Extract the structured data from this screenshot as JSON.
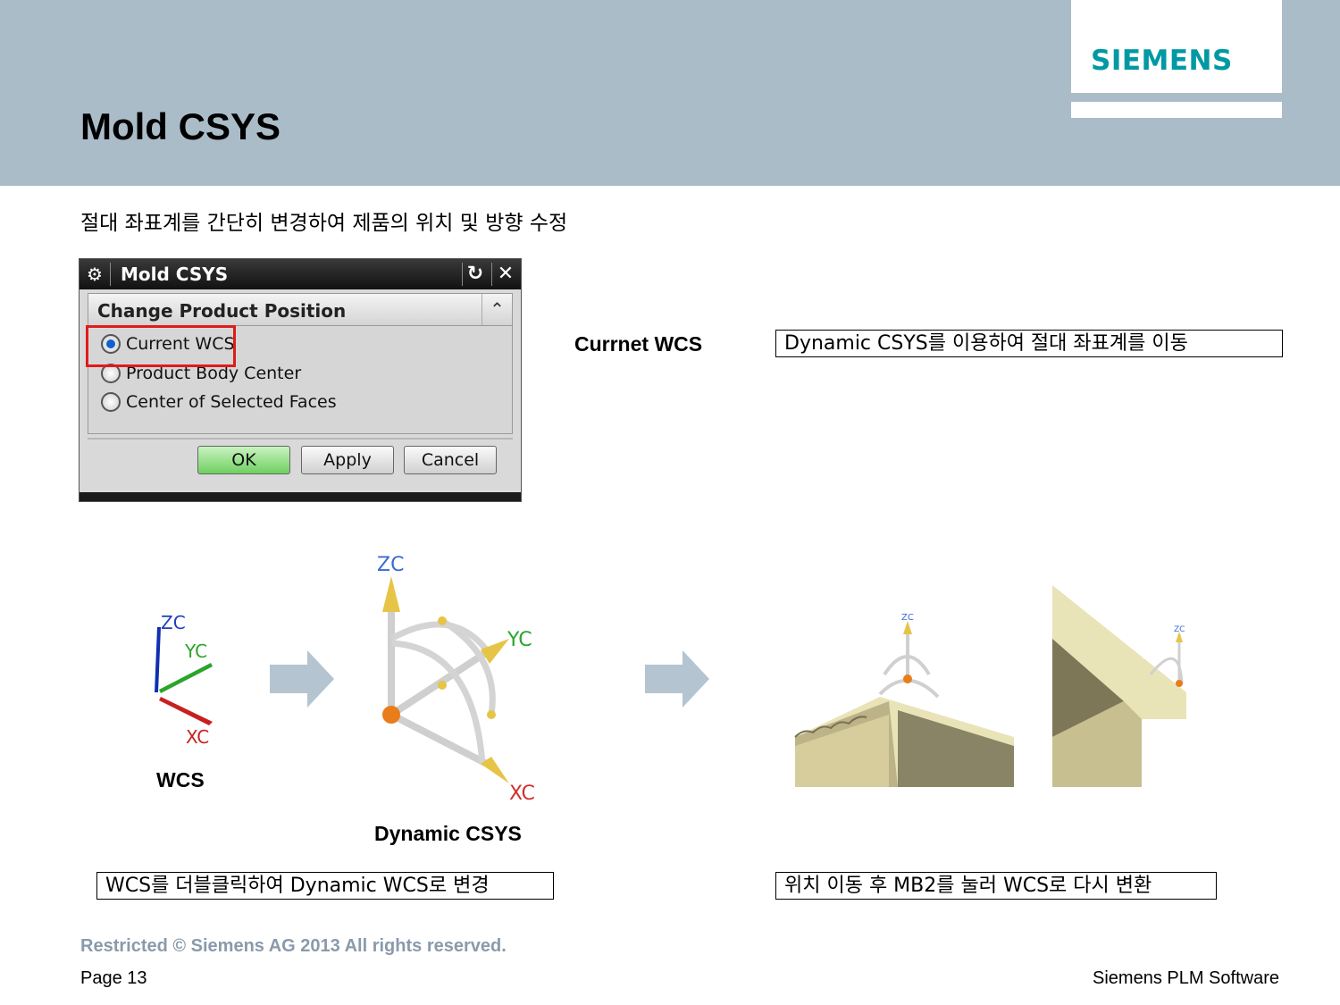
{
  "slide": {
    "title": "Mold CSYS",
    "subtitle": "절대 좌표계를 간단히 변경하여 제품의 위치 및 방향 수정",
    "logo": "SIEMENS",
    "brand_color": "#0099a3",
    "header_color": "#abbcc9"
  },
  "dialog": {
    "title": "Mold CSYS",
    "reset_icon": "reset-icon",
    "close_icon": "close-icon",
    "group_label": "Change Product Position",
    "options": [
      {
        "label": "Current WCS",
        "selected": true
      },
      {
        "label": "Product Body Center",
        "selected": false
      },
      {
        "label": "Center of Selected Faces",
        "selected": false
      }
    ],
    "buttons": {
      "ok": "OK",
      "apply": "Apply",
      "cancel": "Cancel"
    }
  },
  "labels": {
    "current_wcs": "Currnet WCS",
    "note_dynamic": "Dynamic CSYS를 이용하여 절대 좌표계를 이동",
    "wcs": "WCS",
    "dynamic_csys": "Dynamic CSYS",
    "note_doubleclick": "WCS를 더블클릭하여 Dynamic WCS로 변경",
    "note_mb2": "위치 이동 후 MB2를 눌러 WCS로 다시 변환"
  },
  "axes": {
    "z": "ZC",
    "y": "YC",
    "x": "XC"
  },
  "footer": {
    "copyright": "Restricted © Siemens AG 2013 All rights reserved.",
    "page": "Page 13",
    "brand": "Siemens PLM Software"
  }
}
